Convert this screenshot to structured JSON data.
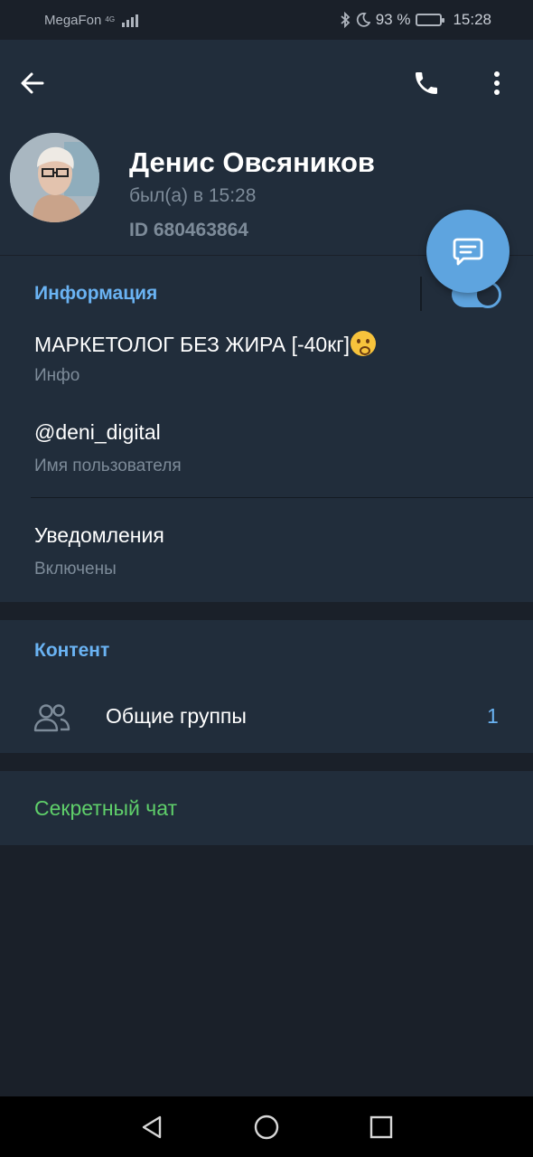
{
  "status_bar": {
    "carrier": "MegaFon",
    "network": "4G",
    "battery_percent": "93 %",
    "battery_level": 0.93,
    "time": "15:28"
  },
  "toolbar": {
    "back_icon": "arrow-left-icon",
    "call_icon": "phone-icon",
    "menu_icon": "more-vertical-icon"
  },
  "profile": {
    "name": "Денис Овсяников",
    "last_seen": "был(а) в 15:28",
    "id": "ID 680463864",
    "message_icon": "message-icon"
  },
  "info": {
    "title": "Информация",
    "bio": "МАРКЕТОЛОГ БЕЗ ЖИРА [-40кг]",
    "bio_label": "Инфо",
    "username": "@deni_digital",
    "username_label": "Имя пользователя",
    "notifications": "Уведомления",
    "notifications_state": "Включены",
    "notifications_on": true
  },
  "content": {
    "title": "Контент",
    "groups_label": "Общие группы",
    "groups_count": "1"
  },
  "secret_chat": {
    "label": "Секретный чат"
  },
  "colors": {
    "background": "#1a2029",
    "panel": "#212d3b",
    "accent": "#6ab3f3",
    "fab": "#5ea4df",
    "secret": "#5fcf6a",
    "muted": "#7d8b99"
  }
}
